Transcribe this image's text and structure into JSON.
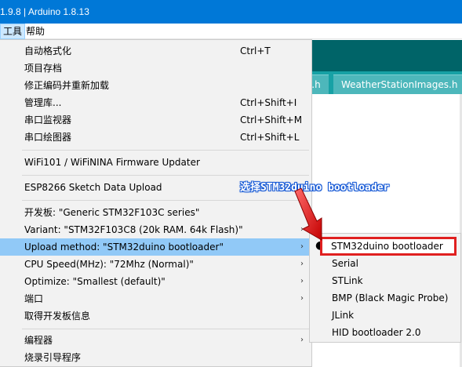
{
  "window": {
    "title": "1.9.8 | Arduino 1.8.13"
  },
  "menubar": {
    "tools": "工具",
    "help": "帮助"
  },
  "ide": {
    "tab_partial": "s.h",
    "tab_weather": "WeatherStationImages.h"
  },
  "menu": {
    "auto_format": {
      "label": "自动格式化",
      "shortcut": "Ctrl+T"
    },
    "archive_sketch": {
      "label": "项目存档"
    },
    "fix_encoding": {
      "label": "修正编码并重新加载"
    },
    "manage_libraries": {
      "label": "管理库...",
      "shortcut": "Ctrl+Shift+I"
    },
    "serial_monitor": {
      "label": "串口监视器",
      "shortcut": "Ctrl+Shift+M"
    },
    "serial_plotter": {
      "label": "串口绘图器",
      "shortcut": "Ctrl+Shift+L"
    },
    "wifi_updater": {
      "label": "WiFi101 / WiFiNINA Firmware Updater"
    },
    "esp_upload": {
      "label": "ESP8266 Sketch Data Upload"
    },
    "board": {
      "label": "开发板: \"Generic STM32F103C series\""
    },
    "variant": {
      "label": "Variant: \"STM32F103C8 (20k RAM. 64k Flash)\""
    },
    "upload_method": {
      "label": "Upload method: \"STM32duino bootloader\""
    },
    "cpu_speed": {
      "label": "CPU Speed(MHz): \"72Mhz (Normal)\""
    },
    "optimize": {
      "label": "Optimize: \"Smallest (default)\""
    },
    "port": {
      "label": "端口"
    },
    "board_info": {
      "label": "取得开发板信息"
    },
    "programmer": {
      "label": "编程器"
    },
    "burn_bootloader": {
      "label": "烧录引导程序"
    },
    "arrow": "›"
  },
  "submenu": {
    "bullet": "●",
    "items": [
      "STM32duino bootloader",
      "Serial",
      "STLink",
      "BMP (Black Magic Probe)",
      "JLink",
      "HID bootloader 2.0"
    ]
  },
  "annotation": {
    "text": "选择STM32duino bootloader"
  },
  "colors": {
    "titlebar": "#0078d7",
    "menu_highlight": "#91c9f7",
    "annotation_box": "#e02020",
    "annotation_text_outline": "#1a5cd6",
    "ide_toolbar": "#006468",
    "ide_tabs": "#17a1a5"
  }
}
